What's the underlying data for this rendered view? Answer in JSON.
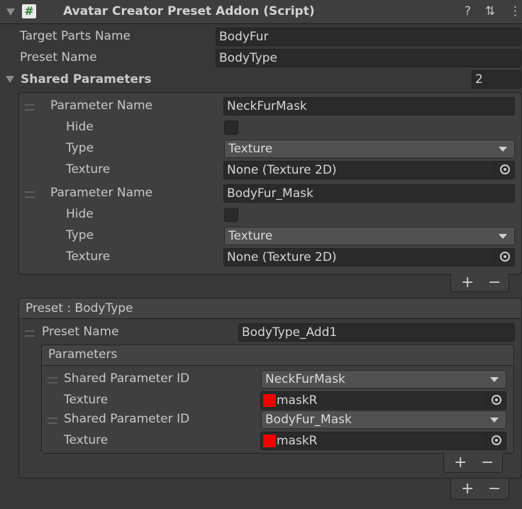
{
  "header": {
    "title": "Avatar Creator Preset Addon (Script)",
    "script_icon": "#",
    "help_icon": "?",
    "settings_icon": "⇅",
    "menu_icon": "⋮"
  },
  "fields": {
    "target_parts_name_label": "Target Parts Name",
    "target_parts_name_value": "BodyFur",
    "preset_name_label": "Preset Name",
    "preset_name_value": "BodyType"
  },
  "shared_parameters": {
    "label": "Shared Parameters",
    "count": "2",
    "items": [
      {
        "param_name_label": "Parameter Name",
        "param_name_value": "NeckFurMask",
        "hide_label": "Hide",
        "type_label": "Type",
        "type_value": "Texture",
        "texture_label": "Texture",
        "texture_value": "None (Texture 2D)"
      },
      {
        "param_name_label": "Parameter Name",
        "param_name_value": "BodyFur_Mask",
        "hide_label": "Hide",
        "type_label": "Type",
        "type_value": "Texture",
        "texture_label": "Texture",
        "texture_value": "None (Texture 2D)"
      }
    ]
  },
  "preset": {
    "header": "Preset : BodyType",
    "preset_name_label": "Preset Name",
    "preset_name_value": "BodyType_Add1",
    "parameters_header": "Parameters",
    "entries": [
      {
        "shared_id_label": "Shared Parameter ID",
        "shared_id_value": "NeckFurMask",
        "texture_label": "Texture",
        "texture_value": "maskR"
      },
      {
        "shared_id_label": "Shared Parameter ID",
        "shared_id_value": "BodyFur_Mask",
        "texture_label": "Texture",
        "texture_value": "maskR"
      }
    ]
  },
  "buttons": {
    "plus": "+",
    "minus": "−"
  },
  "colors": {
    "swatch": "#f20000",
    "background": "#383838"
  }
}
